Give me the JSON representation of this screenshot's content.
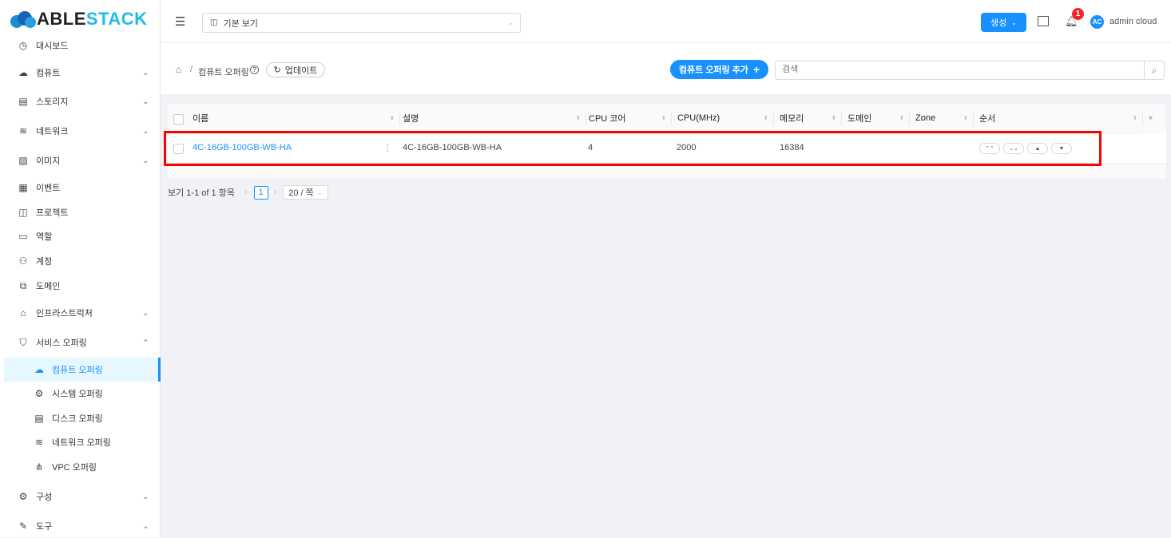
{
  "logo": {
    "part1": "ABLE",
    "part2": "STACK"
  },
  "sidebar": {
    "items": [
      {
        "label": "대시보드",
        "icon": "dashboard-icon",
        "glyph": "◷"
      },
      {
        "label": "컴퓨트",
        "icon": "cloud-icon",
        "glyph": "☁",
        "chevron": "⌄"
      },
      {
        "label": "스토리지",
        "icon": "storage-icon",
        "glyph": "▤",
        "chevron": "⌄"
      },
      {
        "label": "네트워크",
        "icon": "wifi-icon",
        "glyph": "≋",
        "chevron": "⌄"
      },
      {
        "label": "이미지",
        "icon": "picture-icon",
        "glyph": "▨",
        "chevron": "⌄"
      },
      {
        "label": "이벤트",
        "icon": "schedule-icon",
        "glyph": "▦"
      },
      {
        "label": "프로젝트",
        "icon": "project-icon",
        "glyph": "◫"
      },
      {
        "label": "역할",
        "icon": "idcard-icon",
        "glyph": "▭"
      },
      {
        "label": "계정",
        "icon": "team-icon",
        "glyph": "⚇"
      },
      {
        "label": "도메인",
        "icon": "block-icon",
        "glyph": "⧉"
      },
      {
        "label": "인프라스트럭처",
        "icon": "bank-icon",
        "glyph": "⌂",
        "chevron": "⌄"
      },
      {
        "label": "서비스 오퍼링",
        "icon": "shopping-icon",
        "glyph": "⛉",
        "chevron": "⌃"
      },
      {
        "label": "컴퓨트 오퍼링",
        "icon": "cloud-icon",
        "glyph": "☁",
        "sub": true,
        "selected": true
      },
      {
        "label": "시스템 오퍼링",
        "icon": "setting-icon",
        "glyph": "⚙",
        "sub": true
      },
      {
        "label": "디스크 오퍼링",
        "icon": "hdd-icon",
        "glyph": "▤",
        "sub": true
      },
      {
        "label": "네트워크 오퍼링",
        "icon": "wifi-icon",
        "glyph": "≋",
        "sub": true
      },
      {
        "label": "VPC 오퍼링",
        "icon": "deployment-unit-icon",
        "glyph": "⋔",
        "sub": true
      },
      {
        "label": "구성",
        "icon": "setting-icon",
        "glyph": "⚙",
        "chevron": "⌄"
      },
      {
        "label": "도구",
        "icon": "tool-icon",
        "glyph": "✎",
        "chevron": "⌄"
      }
    ]
  },
  "header": {
    "project_select": "기본 보기",
    "create_label": "생성",
    "notification_count": "1",
    "avatar": "AC",
    "user": "admin cloud"
  },
  "toolbar": {
    "breadcrumb_current": "컴퓨트 오퍼링",
    "update_label": "업데이트",
    "add_label": "컴퓨트 오퍼링 추가",
    "search_placeholder": "검색"
  },
  "table": {
    "columns": [
      "이름",
      "설명",
      "CPU 코어",
      "CPU(MHz)",
      "메모리",
      "도메인",
      "Zone",
      "순서"
    ],
    "rows": [
      {
        "name": "4C-16GB-100GB-WB-HA",
        "description": "4C-16GB-100GB-WB-HA",
        "cpu_cores": "4",
        "cpu_mhz": "2000",
        "memory": "16384",
        "domain": "",
        "zone": ""
      }
    ]
  },
  "pagination": {
    "summary": "보기 1-1 of 1 항목",
    "current_page": "1",
    "page_size": "20 / 쪽"
  },
  "colors": {
    "accent": "#1890ff",
    "highlight": "#ff0000"
  }
}
